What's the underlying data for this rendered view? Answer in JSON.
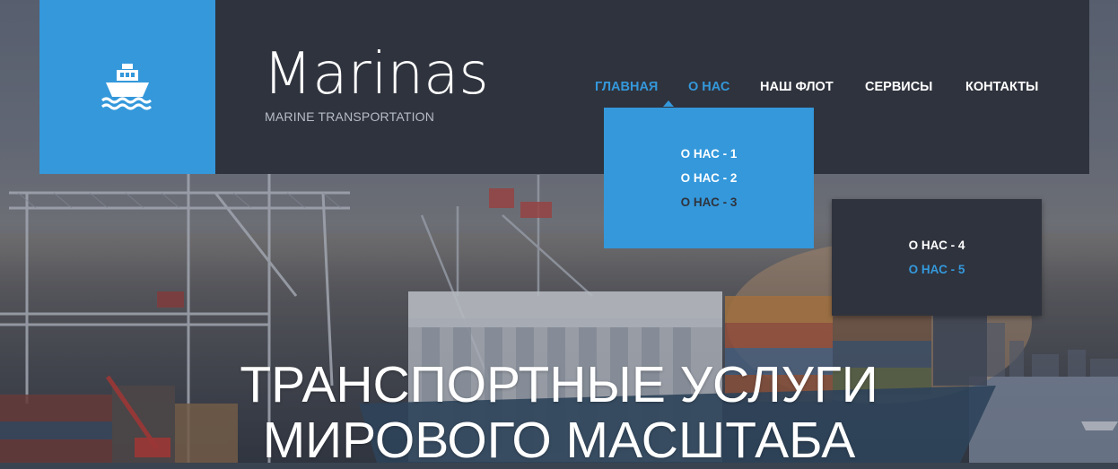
{
  "brand": {
    "title": "Marinas",
    "subtitle": "MARINE TRANSPORTATION",
    "logo_icon": "ship-icon"
  },
  "nav": {
    "items": [
      {
        "label": "ГЛАВНАЯ",
        "state": "active"
      },
      {
        "label": "О НАС",
        "state": "active-open"
      },
      {
        "label": "НАШ ФЛОТ",
        "state": "normal"
      },
      {
        "label": "СЕРВИСЫ",
        "state": "normal"
      },
      {
        "label": "КОНТАКТЫ",
        "state": "normal"
      }
    ]
  },
  "dropdown_about": {
    "items": [
      "О НАС - 1",
      "О НАС - 2",
      "О НАС - 3"
    ]
  },
  "dropdown_sub": {
    "items": [
      "О НАС - 4",
      "О НАС - 5"
    ]
  },
  "hero": {
    "heading_line_1": "ТРАНСПОРТНЫЕ УСЛУГИ",
    "heading_line_2": "МИРОВОГО МАСШТАБА"
  },
  "colors": {
    "accent": "#3498db",
    "header_bg": "#2f333d",
    "text_light": "#ffffff",
    "subtitle": "#b6bcc6"
  }
}
